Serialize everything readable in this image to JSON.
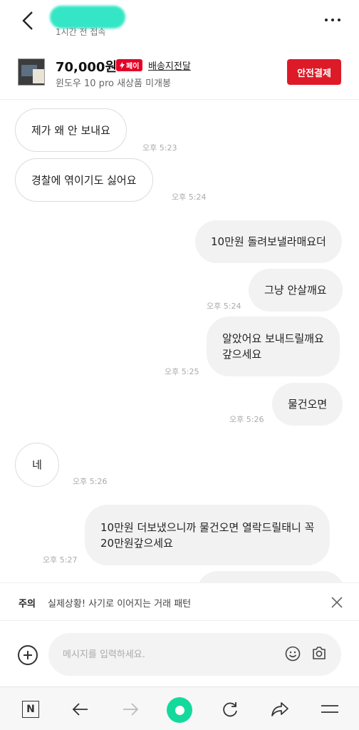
{
  "header": {
    "last_seen": "1시간 전 접속"
  },
  "product": {
    "price": "70,000원",
    "pay_badge": "페이",
    "delivery": "배송지전달",
    "title": "윈도우 10 pro 새상품 미개봉",
    "safe_pay_label": "안전결제"
  },
  "messages": [
    {
      "direction": "received",
      "lines": [
        "제가 왜 안 보내요"
      ],
      "time": "오후 5:23"
    },
    {
      "direction": "received",
      "lines": [
        "경찰에 엮이기도 싫어요"
      ],
      "time": "오후 5:24"
    },
    {
      "direction": "sent",
      "lines": [
        "10만원 돌려보낼라매요더"
      ],
      "time": ""
    },
    {
      "direction": "sent",
      "lines": [
        "그냥 안살깨요"
      ],
      "time": "오후 5:24"
    },
    {
      "direction": "sent",
      "lines": [
        "알았어요 보내드릴깨요",
        "갚으세요"
      ],
      "time": "오후 5:25"
    },
    {
      "direction": "sent",
      "lines": [
        "물건오면"
      ],
      "time": "오후 5:26"
    },
    {
      "direction": "received",
      "lines": [
        "네"
      ],
      "time": "오후 5:26"
    },
    {
      "direction": "sent",
      "lines": [
        "10만원 더보냈으니까 물건오면 열락드릴태니 꼭",
        "20만원갚으세요"
      ],
      "time": "오후 5:27"
    }
  ],
  "warning": {
    "title": "주의",
    "text": "실제상황! 사기로 이어지는 거래 패턴"
  },
  "input": {
    "placeholder": "메시지를 입력하세요."
  },
  "icons": {
    "back": "chevron-left-icon",
    "more": "more-dots-icon",
    "close": "close-icon",
    "plus": "plus-circle-icon",
    "emoji": "smiley-icon",
    "camera": "camera-icon"
  },
  "colors": {
    "accent_red": "#dd1a28",
    "browser_green": "#14d99d"
  }
}
